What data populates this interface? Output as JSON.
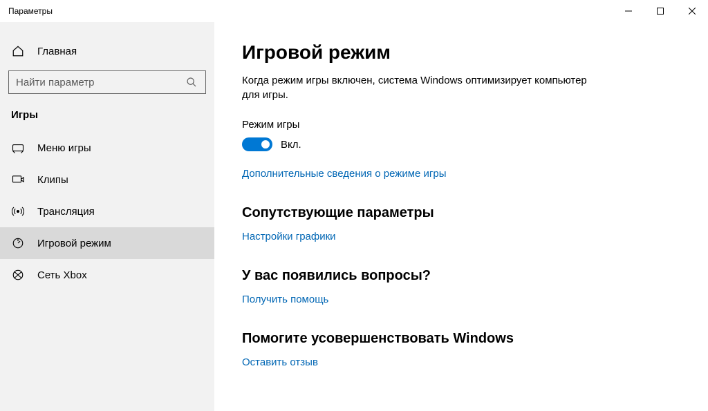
{
  "window": {
    "title": "Параметры"
  },
  "sidebar": {
    "home_label": "Главная",
    "search_placeholder": "Найти параметр",
    "category_label": "Игры",
    "items": [
      {
        "label": "Меню игры"
      },
      {
        "label": "Клипы"
      },
      {
        "label": "Трансляция"
      },
      {
        "label": "Игровой режим"
      },
      {
        "label": "Сеть Xbox"
      }
    ]
  },
  "content": {
    "title": "Игровой режим",
    "description": "Когда режим игры включен, система Windows оптимизирует компьютер для игры.",
    "game_mode_label": "Режим игры",
    "toggle_state_label": "Вкл.",
    "learn_more_link": "Дополнительные сведения о режиме игры",
    "related": {
      "title": "Сопутствующие параметры",
      "link": "Настройки графики"
    },
    "help": {
      "title": "У вас появились вопросы?",
      "link": "Получить помощь"
    },
    "feedback": {
      "title": "Помогите усовершенствовать Windows",
      "link": "Оставить отзыв"
    }
  }
}
